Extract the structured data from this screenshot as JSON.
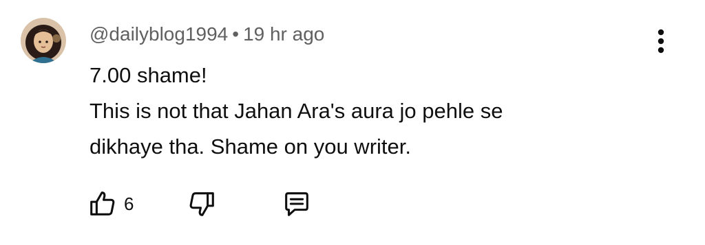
{
  "comment": {
    "author": "@dailyblog1994",
    "separator": "•",
    "time": "19 hr ago",
    "lines": [
      "7.00 shame!",
      "This is not that Jahan Ara's aura jo pehle se",
      "dikhaye tha. Shame on you writer."
    ],
    "likes": "6"
  },
  "icons": {
    "avatar": "avatar-illustration",
    "menu": "more-vert-icon",
    "like": "thumbs-up-icon",
    "dislike": "thumbs-down-icon",
    "reply": "reply-comment-icon"
  },
  "colors": {
    "text": "#0f0f0f",
    "meta": "#606060",
    "avatar_bg": "#d9c2a8",
    "avatar_hair": "#2a1b16"
  }
}
